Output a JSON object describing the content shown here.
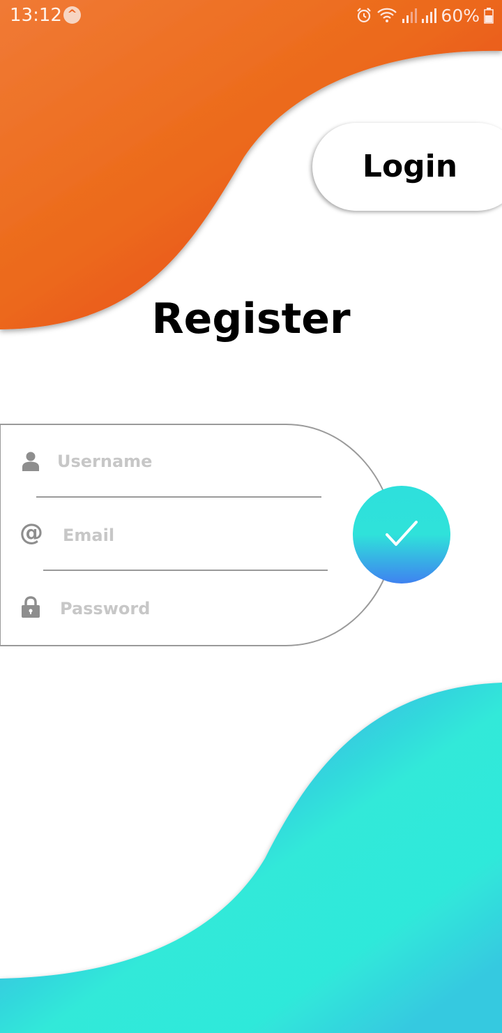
{
  "status_bar": {
    "time": "13:12",
    "app_icon_glyph": "^",
    "battery_percent": "60%",
    "icons": [
      "alarm-icon",
      "wifi-icon",
      "signal-icon",
      "signal-icon",
      "battery-icon"
    ]
  },
  "login_button": {
    "label": "Login"
  },
  "title": "Register",
  "form": {
    "username": {
      "placeholder": "Username",
      "value": "",
      "icon": "user-icon"
    },
    "email": {
      "placeholder": "Email",
      "value": "",
      "icon": "at-icon",
      "icon_glyph": "@"
    },
    "password": {
      "placeholder": "Password",
      "value": "",
      "icon": "lock-icon"
    }
  },
  "submit": {
    "icon": "checkmark-icon"
  },
  "colors": {
    "top_gradient_start": "#f07a35",
    "top_gradient_mid": "#ec6a1a",
    "top_gradient_end": "#e63a26",
    "bottom_gradient_start": "#4286ef",
    "bottom_gradient_end": "#2fe8d8",
    "submit_gradient_start": "#2ee0dc",
    "submit_gradient_end": "#3f82f0"
  }
}
